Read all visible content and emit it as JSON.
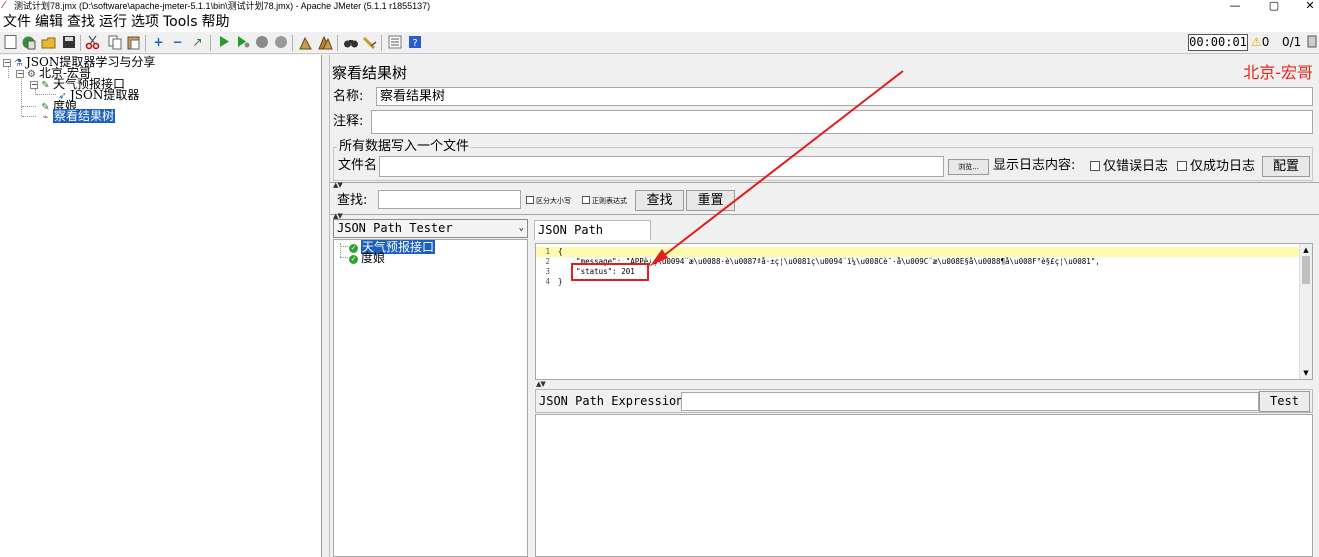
{
  "window": {
    "title": "测试计划78.jmx (D:\\software\\apache-jmeter-5.1.1\\bin\\测试计划78.jmx) - Apache JMeter (5.1.1 r1855137)",
    "minimize_glyph": "—",
    "maximize_glyph": "▢",
    "close_glyph": "✕"
  },
  "menu": {
    "items": [
      "文件",
      "编辑",
      "查找",
      "运行",
      "选项",
      "Tools",
      "帮助"
    ]
  },
  "toolbar": {
    "timer": "00:00:01",
    "warn_count": "0",
    "threads": "0/1"
  },
  "tree": {
    "nodes": [
      {
        "label": "JSON提取器学习与分享"
      },
      {
        "label": "北京-宏哥"
      },
      {
        "label": "天气预报接口"
      },
      {
        "label": "JSON提取器"
      },
      {
        "label": "度娘"
      },
      {
        "label": "察看结果树"
      }
    ]
  },
  "panel": {
    "heading": "察看结果树",
    "brand": "北京-宏哥",
    "name_label": "名称:",
    "name_value": "察看结果树",
    "comment_label": "注释:",
    "comment_value": "",
    "file_group_title": "所有数据写入一个文件",
    "file_label": "文件名",
    "browse_button": "浏览...",
    "log_label": "显示日志内容:",
    "errors_only": "仅错误日志",
    "success_only": "仅成功日志",
    "config_button": "配置",
    "search_label": "查找:",
    "search_value": "",
    "case_sensitive": "区分大小写",
    "regex": "正则表达式",
    "find_button": "查找",
    "reset_button": "重置"
  },
  "renderer": {
    "selected": "JSON Path Tester",
    "results": [
      {
        "label": "天气预报接口",
        "status": "success"
      },
      {
        "label": "度娘",
        "status": "success"
      }
    ]
  },
  "tester": {
    "tab_label": "JSON Path Tester",
    "code_lines": [
      {
        "n": "1",
        "text": "{"
      },
      {
        "n": "2",
        "text": "    \"message\": \"APPè¿ç\\u0094¨æ\\u0088·è\\u0087ªå·±ç¦\\u0081ç\\u0094¨ï¼\\u008Cè¯·å\\u009C¨æ\\u008E§å\\u0088¶å\\u008F°è§£ç¦\\u0081\","
      },
      {
        "n": "3",
        "text": "    \"status\": 201"
      },
      {
        "n": "4",
        "text": "}"
      }
    ],
    "expr_label": "JSON Path Expression",
    "expr_value": "",
    "test_button": "Test"
  },
  "colors": {
    "selection": "#1b5fbf",
    "brand": "#e8271d",
    "annotation": "#e02020",
    "highlight_line": "#fdfbb0"
  }
}
